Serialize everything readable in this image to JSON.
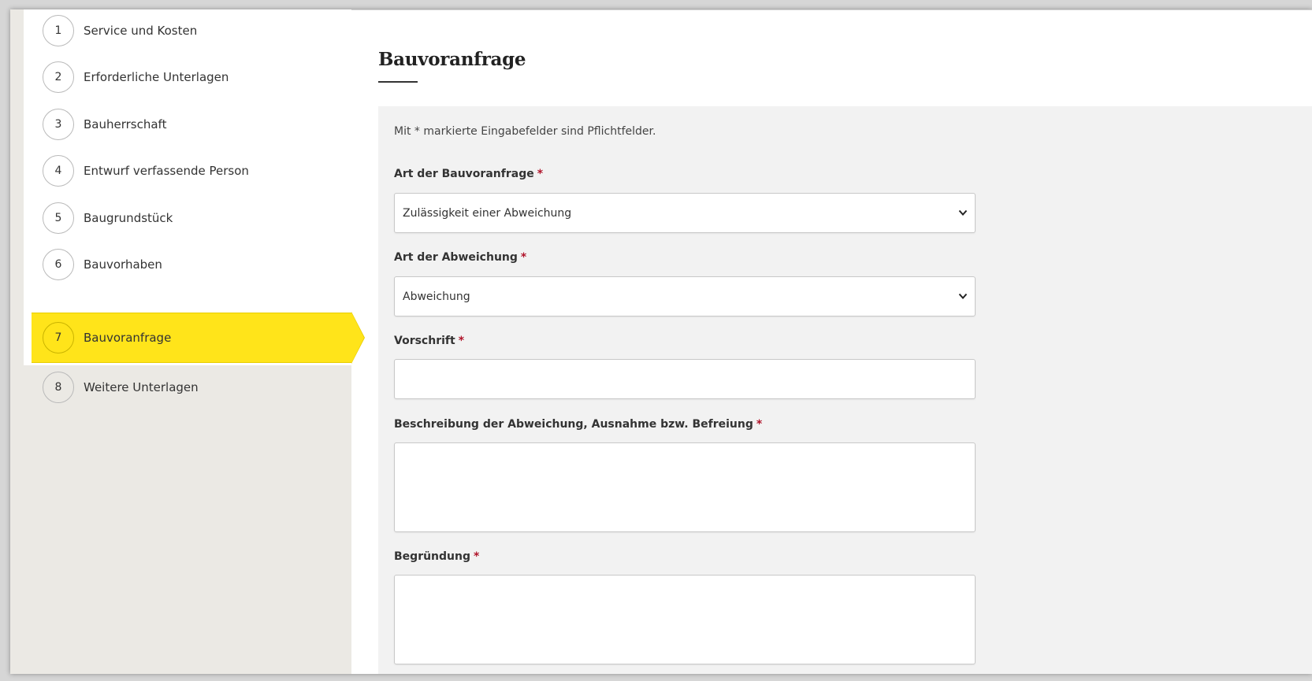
{
  "sidebar": {
    "steps": [
      {
        "number": "1",
        "label": "Service und Kosten"
      },
      {
        "number": "2",
        "label": "Erforderliche Unterlagen"
      },
      {
        "number": "3",
        "label": "Bauherrschaft"
      },
      {
        "number": "4",
        "label": "Entwurf verfassende Person"
      },
      {
        "number": "5",
        "label": "Baugrundstück"
      },
      {
        "number": "6",
        "label": "Bauvorhaben"
      },
      {
        "number": "7",
        "label": "Bauvoranfrage"
      },
      {
        "number": "8",
        "label": "Weitere Unterlagen"
      }
    ],
    "active_step": "7"
  },
  "main": {
    "title": "Bauvoranfrage",
    "hint": "Mit * markierte Eingabefelder sind Pflichtfelder.",
    "required_marker": "*",
    "fields": {
      "art_bauvoranfrage": {
        "label": "Art der Bauvoranfrage",
        "value": "Zulässigkeit einer Abweichung"
      },
      "art_abweichung": {
        "label": "Art der Abweichung",
        "value": "Abweichung"
      },
      "vorschrift": {
        "label": "Vorschrift",
        "value": ""
      },
      "beschreibung": {
        "label": "Beschreibung der Abweichung, Ausnahme bzw. Befreiung",
        "value": ""
      },
      "begruendung": {
        "label": "Begründung",
        "value": ""
      }
    }
  },
  "colors": {
    "active_step": "#ffe41a",
    "required": "#b0142a",
    "sidebar_bg": "#ebe9e4",
    "form_bg": "#f2f2f2"
  },
  "icons": {
    "select_chevron": "chevron-down-icon"
  }
}
